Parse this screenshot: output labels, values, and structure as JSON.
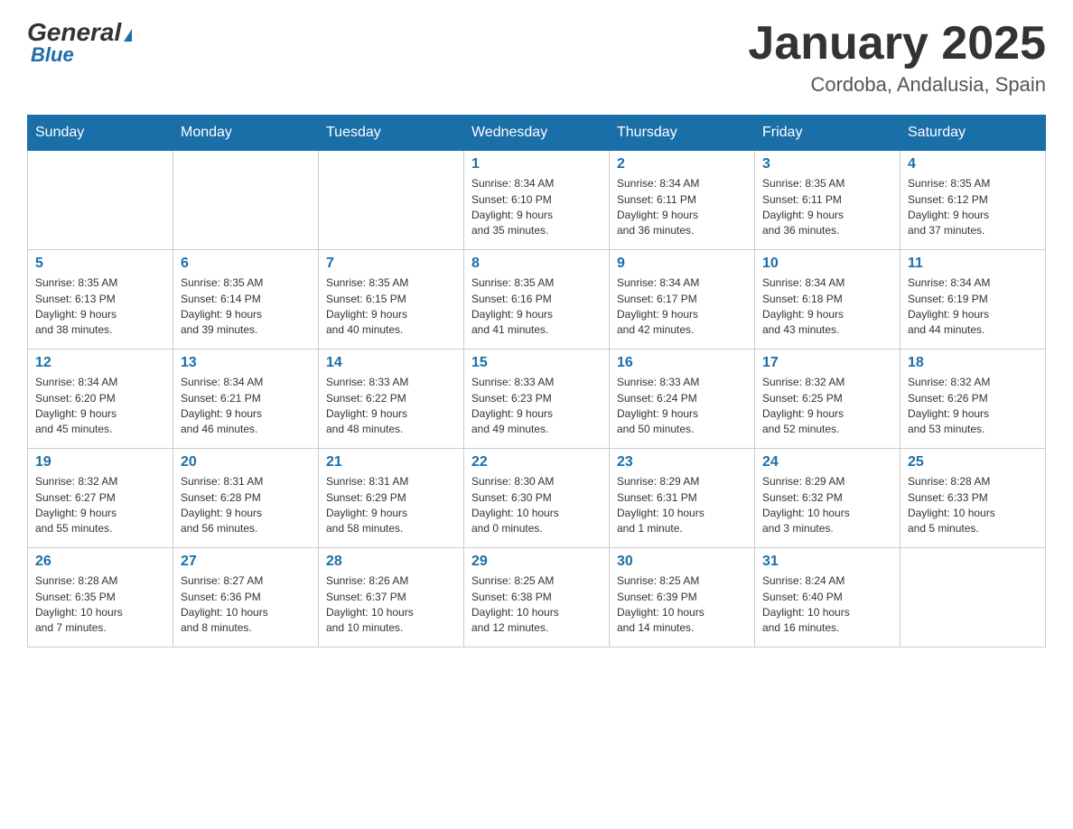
{
  "logo": {
    "general": "General",
    "arrow": "▶",
    "blue": "Blue"
  },
  "title": "January 2025",
  "subtitle": "Cordoba, Andalusia, Spain",
  "weekdays": [
    "Sunday",
    "Monday",
    "Tuesday",
    "Wednesday",
    "Thursday",
    "Friday",
    "Saturday"
  ],
  "weeks": [
    [
      {
        "day": "",
        "info": ""
      },
      {
        "day": "",
        "info": ""
      },
      {
        "day": "",
        "info": ""
      },
      {
        "day": "1",
        "info": "Sunrise: 8:34 AM\nSunset: 6:10 PM\nDaylight: 9 hours\nand 35 minutes."
      },
      {
        "day": "2",
        "info": "Sunrise: 8:34 AM\nSunset: 6:11 PM\nDaylight: 9 hours\nand 36 minutes."
      },
      {
        "day": "3",
        "info": "Sunrise: 8:35 AM\nSunset: 6:11 PM\nDaylight: 9 hours\nand 36 minutes."
      },
      {
        "day": "4",
        "info": "Sunrise: 8:35 AM\nSunset: 6:12 PM\nDaylight: 9 hours\nand 37 minutes."
      }
    ],
    [
      {
        "day": "5",
        "info": "Sunrise: 8:35 AM\nSunset: 6:13 PM\nDaylight: 9 hours\nand 38 minutes."
      },
      {
        "day": "6",
        "info": "Sunrise: 8:35 AM\nSunset: 6:14 PM\nDaylight: 9 hours\nand 39 minutes."
      },
      {
        "day": "7",
        "info": "Sunrise: 8:35 AM\nSunset: 6:15 PM\nDaylight: 9 hours\nand 40 minutes."
      },
      {
        "day": "8",
        "info": "Sunrise: 8:35 AM\nSunset: 6:16 PM\nDaylight: 9 hours\nand 41 minutes."
      },
      {
        "day": "9",
        "info": "Sunrise: 8:34 AM\nSunset: 6:17 PM\nDaylight: 9 hours\nand 42 minutes."
      },
      {
        "day": "10",
        "info": "Sunrise: 8:34 AM\nSunset: 6:18 PM\nDaylight: 9 hours\nand 43 minutes."
      },
      {
        "day": "11",
        "info": "Sunrise: 8:34 AM\nSunset: 6:19 PM\nDaylight: 9 hours\nand 44 minutes."
      }
    ],
    [
      {
        "day": "12",
        "info": "Sunrise: 8:34 AM\nSunset: 6:20 PM\nDaylight: 9 hours\nand 45 minutes."
      },
      {
        "day": "13",
        "info": "Sunrise: 8:34 AM\nSunset: 6:21 PM\nDaylight: 9 hours\nand 46 minutes."
      },
      {
        "day": "14",
        "info": "Sunrise: 8:33 AM\nSunset: 6:22 PM\nDaylight: 9 hours\nand 48 minutes."
      },
      {
        "day": "15",
        "info": "Sunrise: 8:33 AM\nSunset: 6:23 PM\nDaylight: 9 hours\nand 49 minutes."
      },
      {
        "day": "16",
        "info": "Sunrise: 8:33 AM\nSunset: 6:24 PM\nDaylight: 9 hours\nand 50 minutes."
      },
      {
        "day": "17",
        "info": "Sunrise: 8:32 AM\nSunset: 6:25 PM\nDaylight: 9 hours\nand 52 minutes."
      },
      {
        "day": "18",
        "info": "Sunrise: 8:32 AM\nSunset: 6:26 PM\nDaylight: 9 hours\nand 53 minutes."
      }
    ],
    [
      {
        "day": "19",
        "info": "Sunrise: 8:32 AM\nSunset: 6:27 PM\nDaylight: 9 hours\nand 55 minutes."
      },
      {
        "day": "20",
        "info": "Sunrise: 8:31 AM\nSunset: 6:28 PM\nDaylight: 9 hours\nand 56 minutes."
      },
      {
        "day": "21",
        "info": "Sunrise: 8:31 AM\nSunset: 6:29 PM\nDaylight: 9 hours\nand 58 minutes."
      },
      {
        "day": "22",
        "info": "Sunrise: 8:30 AM\nSunset: 6:30 PM\nDaylight: 10 hours\nand 0 minutes."
      },
      {
        "day": "23",
        "info": "Sunrise: 8:29 AM\nSunset: 6:31 PM\nDaylight: 10 hours\nand 1 minute."
      },
      {
        "day": "24",
        "info": "Sunrise: 8:29 AM\nSunset: 6:32 PM\nDaylight: 10 hours\nand 3 minutes."
      },
      {
        "day": "25",
        "info": "Sunrise: 8:28 AM\nSunset: 6:33 PM\nDaylight: 10 hours\nand 5 minutes."
      }
    ],
    [
      {
        "day": "26",
        "info": "Sunrise: 8:28 AM\nSunset: 6:35 PM\nDaylight: 10 hours\nand 7 minutes."
      },
      {
        "day": "27",
        "info": "Sunrise: 8:27 AM\nSunset: 6:36 PM\nDaylight: 10 hours\nand 8 minutes."
      },
      {
        "day": "28",
        "info": "Sunrise: 8:26 AM\nSunset: 6:37 PM\nDaylight: 10 hours\nand 10 minutes."
      },
      {
        "day": "29",
        "info": "Sunrise: 8:25 AM\nSunset: 6:38 PM\nDaylight: 10 hours\nand 12 minutes."
      },
      {
        "day": "30",
        "info": "Sunrise: 8:25 AM\nSunset: 6:39 PM\nDaylight: 10 hours\nand 14 minutes."
      },
      {
        "day": "31",
        "info": "Sunrise: 8:24 AM\nSunset: 6:40 PM\nDaylight: 10 hours\nand 16 minutes."
      },
      {
        "day": "",
        "info": ""
      }
    ]
  ]
}
